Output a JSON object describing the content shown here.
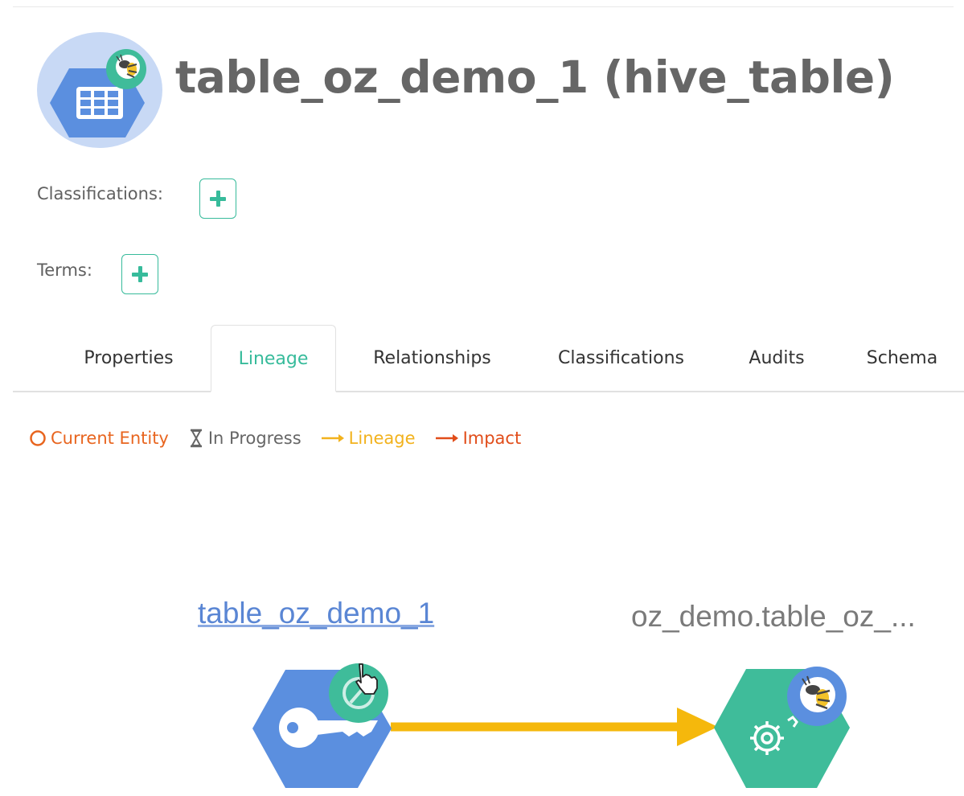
{
  "entity": {
    "title": "table_oz_demo_1 (hive_table)",
    "icon": "table-icon",
    "badge_icon": "hive-bee-icon"
  },
  "fields": {
    "classifications_label": "Classifications:",
    "terms_label": "Terms:",
    "add_icon": "plus-icon"
  },
  "tabs": [
    {
      "label": "Properties",
      "active": false
    },
    {
      "label": "Lineage",
      "active": true
    },
    {
      "label": "Relationships",
      "active": false
    },
    {
      "label": "Classifications",
      "active": false
    },
    {
      "label": "Audits",
      "active": false
    },
    {
      "label": "Schema",
      "active": false
    }
  ],
  "legend": [
    {
      "label": "Current Entity",
      "icon": "circle-outline-icon",
      "color": "#e8651f"
    },
    {
      "label": "In Progress",
      "icon": "hourglass-icon",
      "color": "#666666"
    },
    {
      "label": "Lineage",
      "icon": "arrow-right-icon",
      "color": "#f2b21d"
    },
    {
      "label": "Impact",
      "icon": "arrow-right-icon",
      "color": "#e14d1a"
    }
  ],
  "lineage": {
    "source": {
      "label": "table_oz_demo_1",
      "icon": "key-icon",
      "badge_icon": "hive-bee-icon"
    },
    "target": {
      "label": "oz_demo.table_oz_...",
      "icon": "gear-icon",
      "badge_icon": "hive-bee-icon"
    },
    "edge_color": "#f5b80c"
  },
  "colors": {
    "accent": "#37bb9b",
    "blue": "#5a8ee0",
    "green": "#3fbc9a"
  }
}
